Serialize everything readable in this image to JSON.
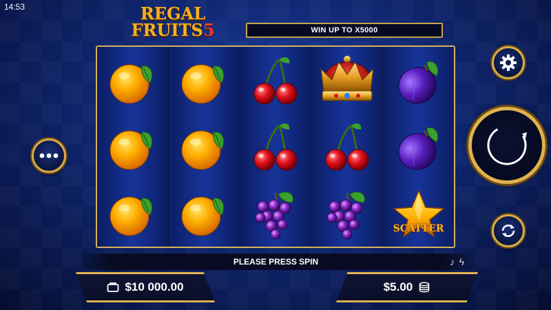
{
  "status_bar": {
    "time": "14:53"
  },
  "logo": {
    "line1": "REGAL",
    "line2": "FRUITS",
    "number": "5"
  },
  "win_banner": "WIN UP TO X5000",
  "reels": [
    [
      "orange",
      "orange",
      "orange"
    ],
    [
      "orange",
      "orange",
      "orange"
    ],
    [
      "cherry",
      "cherry",
      "grapes"
    ],
    [
      "crown",
      "cherry",
      "grapes"
    ],
    [
      "plum",
      "plum",
      "scatter"
    ]
  ],
  "scatter_label": "SCATTER",
  "message": "PLEASE PRESS SPIN",
  "balance": {
    "value": "$10 000.00",
    "icon": "wallet-icon"
  },
  "bet": {
    "value": "$5.00",
    "icon": "coins-icon"
  },
  "buttons": {
    "menu": "more-icon",
    "settings": "gear-icon",
    "spin": "spin-arrow-icon",
    "autoplay": "autoplay-icon"
  },
  "toggles": {
    "sound": "music-note-icon",
    "turbo": "lightning-icon"
  },
  "colors": {
    "gold": "#e0b24f",
    "background": "#0f2670",
    "panel": "#0a0e28"
  }
}
